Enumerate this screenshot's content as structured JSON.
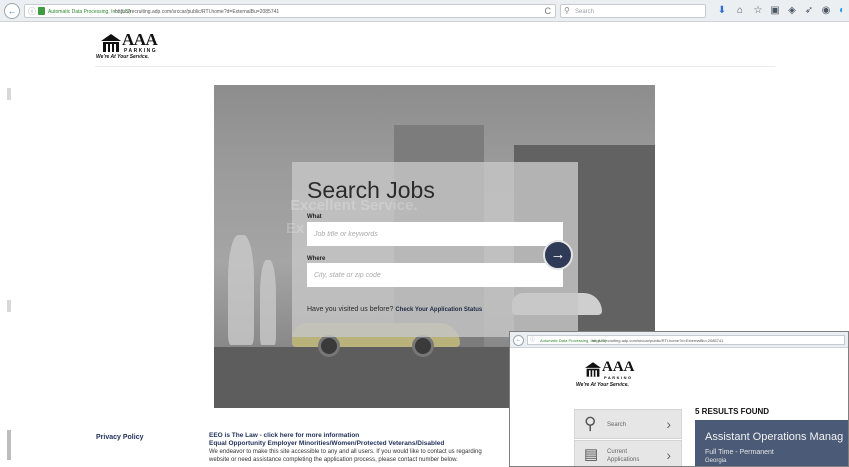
{
  "browser": {
    "site_identity": "Automatic Data Processing, Inc. (US)",
    "url": "https://recruiting.adp.com/srccar/public/RTI.home?d=ExternalBu=2085741",
    "search_placeholder": "Search",
    "reload_glyph": "C",
    "back_glyph": "←"
  },
  "header": {
    "logo_text": "AAA",
    "logo_sub": "PARKING",
    "tagline": "We're At Your Service."
  },
  "hero": {
    "title": "Search Jobs",
    "watermark_line1": "Excellent Service.",
    "watermark_line2": "Ex",
    "what_label": "What",
    "what_placeholder": "Job title or keywords",
    "where_label": "Where",
    "where_placeholder": "City, state or zip code",
    "go_glyph": "→",
    "visited_prefix": "Have you visited us before?",
    "visited_link": "Check Your Application Status"
  },
  "footer": {
    "privacy": "Privacy Policy",
    "eeo_line": "EEO is The Law - click here for more information",
    "employer_line": "Equal Opportunity Employer Minorities/Women/Protected Veterans/Disabled",
    "access_line1": "We endeavor to make this site accessible to any and all users. If you would like to contact us regarding",
    "access_line2": "website or need assistance completing the application process, please contact number below."
  },
  "overlay": {
    "site_identity": "Automatic Data Processing, Inc. (US)",
    "url": "https://recruiting.adp.com/srccar/public/RTI.home?d=ExternalBu=2085741",
    "logo_text": "AAA",
    "logo_sub": "PARKING",
    "tagline": "We're At Your Service.",
    "sidebar": [
      {
        "label": "Search",
        "icon": "search-icon"
      },
      {
        "label": "Current\nApplications",
        "icon": "applications-icon"
      }
    ],
    "results_count": "5 RESULTS FOUND",
    "job": {
      "title": "Assistant Operations Manag",
      "type": "Full Time - Permanent",
      "location": "Georgia"
    }
  },
  "colors": {
    "navy": "#2e3a56",
    "footer_link": "#1f2f57",
    "job_card": "#4b5a76",
    "secure_green": "#3f9b3f"
  }
}
